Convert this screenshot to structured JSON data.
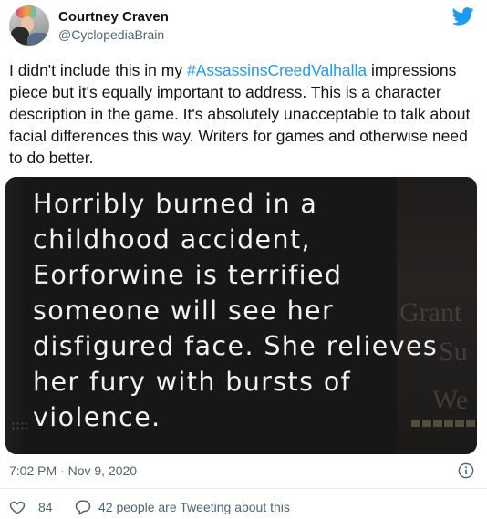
{
  "author": {
    "name": "Courtney Craven",
    "handle": "@CyclopediaBrain"
  },
  "tweet": {
    "text_before": "I didn't include this in my ",
    "hashtag": "#AssassinsCreedValhalla",
    "text_after": " impressions piece but it's equally important to address. This is a character description in the game. It's absolutely unacceptable to talk about facial differences this way. Writers for games and otherwise need to do better.",
    "timestamp": "7:02 PM · Nov 9, 2020"
  },
  "media": {
    "caption": "Horribly burned in a childhood accident, Eorforwine is terrified someone will see her disfigured face. She relieves her fury with bursts of violence.",
    "bg_text_1": "Grant",
    "bg_text_2": "Su",
    "bg_text_3": "We"
  },
  "actions": {
    "like_count": "84",
    "reply_text": "42 people are Tweeting about this"
  },
  "colors": {
    "accent": "#1d9bf0",
    "muted": "#536471",
    "text": "#0f1419"
  },
  "icons": {
    "brand": "twitter-bird-icon",
    "info": "info-icon",
    "like": "heart-icon",
    "reply": "speech-bubble-icon"
  }
}
